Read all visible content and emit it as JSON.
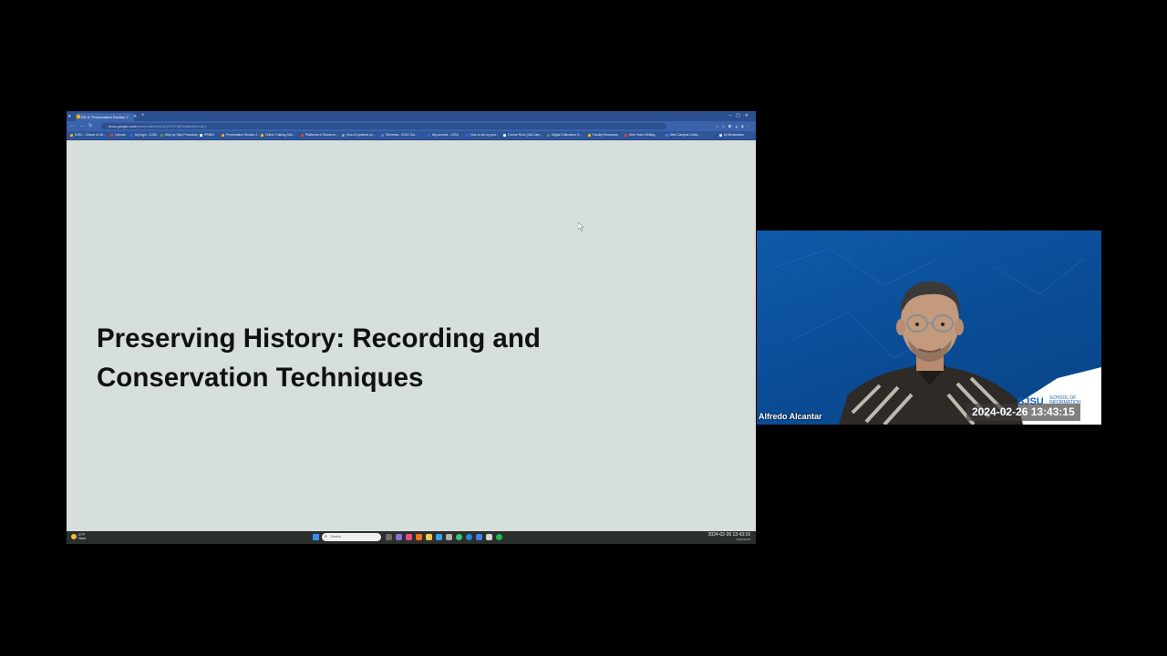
{
  "browser": {
    "tab_title": "RE-9: Preservation Section 2",
    "url_domain": "docs.google.com",
    "url_path": "/presentation/d/1bQnFhTr8E/edit#slide=id.p",
    "bookmarks": [
      "SJSU - School of Inf...",
      "Canvas",
      "My login - SJSU",
      "Step by Step Procedure",
      "PRIMO",
      "Preservation Section 2...",
      "Online Training Sub...",
      "Platforms & Resource...",
      "How AI systems se...",
      "Elements - SJSU Gal...",
      "My account - SJSU",
      "How to set up your...",
      "Course Rush (Old Cam...",
      "Digital Collections S...",
      "Faculty Resources",
      "New Year's Writing...",
      "New Campus Cente...",
      "All Bookmarks"
    ]
  },
  "slide": {
    "title": "Preserving History: Recording and Conservation Techniques"
  },
  "taskbar": {
    "weather_temp": "27°F",
    "weather_desc": "Haze",
    "search_placeholder": "Search",
    "clock_time": "2024-02-26  13:43:16",
    "clock_sub": "2024-02-26"
  },
  "webcam": {
    "participant_name": "Alfredo Alcantar",
    "timestamp": "2024-02-26  13:43:15",
    "logo": "SJSU",
    "logo_sub": "SCHOOL OF INFORMATION"
  },
  "colors": {
    "page_bg": "#000000",
    "slide_bg": "#d6dfdc",
    "browser_chrome": "#3a63ab",
    "webcam_bg": "#0a4c95"
  }
}
